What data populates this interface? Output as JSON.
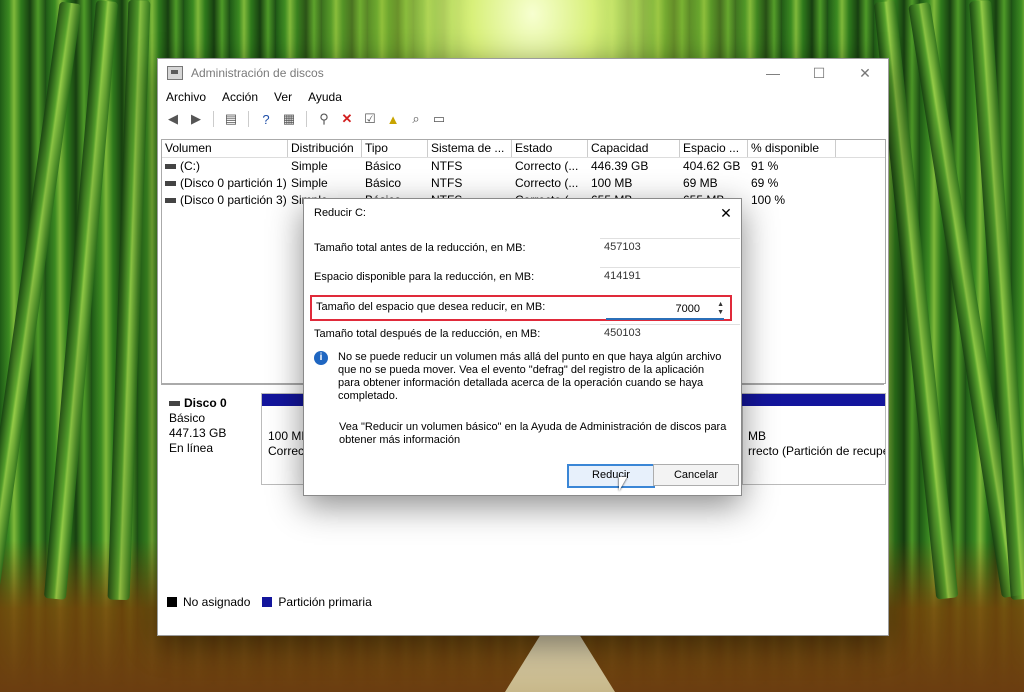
{
  "window": {
    "title": "Administración de discos",
    "controls": [
      "—",
      "☐",
      "✕"
    ]
  },
  "menu": [
    "Archivo",
    "Acción",
    "Ver",
    "Ayuda"
  ],
  "table": {
    "columns": [
      "Volumen",
      "Distribución",
      "Tipo",
      "Sistema de ...",
      "Estado",
      "Capacidad",
      "Espacio ...",
      "% disponible"
    ],
    "rows": [
      [
        "(C:)",
        "Simple",
        "Básico",
        "NTFS",
        "Correcto (...",
        "446.39 GB",
        "404.62 GB",
        "91 %"
      ],
      [
        "(Disco 0 partición 1)",
        "Simple",
        "Básico",
        "NTFS",
        "Correcto (...",
        "100 MB",
        "69 MB",
        "69 %"
      ],
      [
        "(Disco 0 partición 3)",
        "Simple",
        "Básico",
        "NTFS",
        "Correcto (...",
        "655 MB",
        "655 MB",
        "100 %"
      ]
    ]
  },
  "disk": {
    "name": "Disco 0",
    "type": "Básico",
    "size": "447.13 GB",
    "status": "En línea",
    "partitions": [
      {
        "line1": "100 MB",
        "line2": "Correct"
      },
      {
        "line1": "MB",
        "line2": "rrecto (Partición de recuper"
      }
    ]
  },
  "legend": [
    {
      "label": "No asignado",
      "color": "#000000"
    },
    {
      "label": "Partición primaria",
      "color": "#13159c"
    }
  ],
  "dialog": {
    "title": "Reducir C:",
    "close": "✕",
    "fields": [
      {
        "label": "Tamaño total antes de la reducción, en MB:",
        "value": "457103"
      },
      {
        "label": "Espacio disponible para la reducción, en MB:",
        "value": "414191"
      },
      {
        "label": "Tamaño del espacio que desea reducir, en MB:",
        "value": "7000"
      },
      {
        "label": "Tamaño total después de la reducción, en MB:",
        "value": "450103"
      }
    ],
    "info": "No se puede reducir un volumen más allá del punto en que haya algún archivo que no se pueda mover. Vea el evento \"defrag\" del registro de la aplicación para obtener información detallada acerca de la operación cuando se haya completado.",
    "help": "Vea \"Reducir un volumen básico\" en la Ayuda de Administración de discos para obtener más información",
    "buttons": {
      "primary": "Reducir",
      "cancel": "Cancelar"
    }
  }
}
